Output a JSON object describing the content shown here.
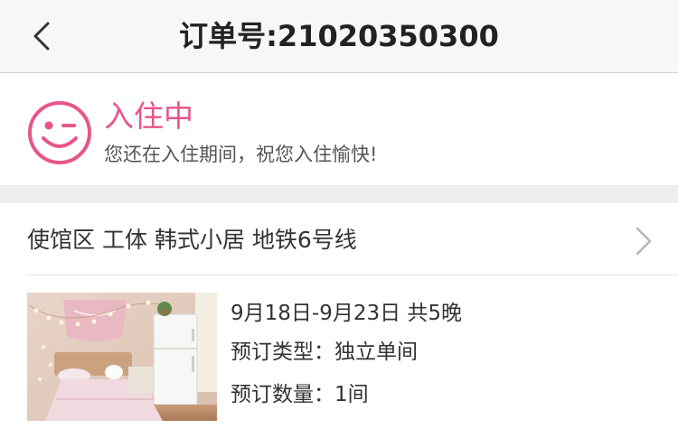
{
  "navbar": {
    "back_icon": "chevron-left-icon",
    "title": "订单号:21020350300"
  },
  "status": {
    "icon": "smiley-wink-icon",
    "title": "入住中",
    "message": "您还在入住期间，祝您入住愉快!",
    "accent_color": "#e8558a"
  },
  "hotel": {
    "name": "使馆区 工体 韩式小居 地铁6号线",
    "arrow_icon": "chevron-right-icon"
  },
  "booking": {
    "dates": "9月18日-9月23日 共5晚",
    "type_label": "预订类型：",
    "type_value": "独立单间",
    "count_label": "预订数量：",
    "count_value": "1间"
  }
}
